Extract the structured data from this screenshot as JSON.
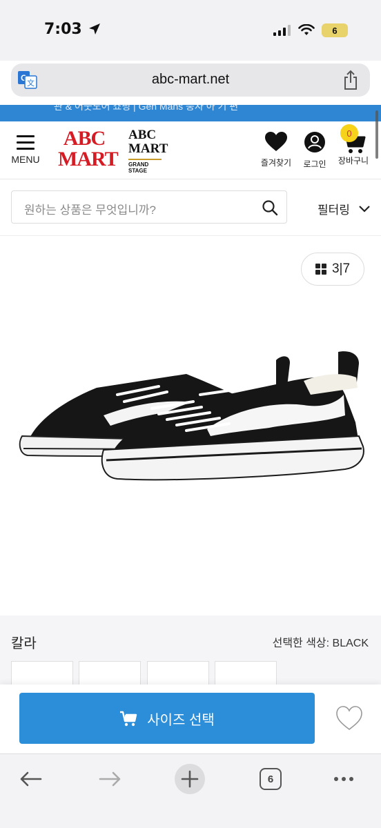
{
  "status_bar": {
    "time": "7:03",
    "battery": "6"
  },
  "browser": {
    "url": "abc-mart.net",
    "tab_count": "6"
  },
  "banner": {
    "text": "관 & 어웃도어 쇼핑 | Gen Mans 풍자 아 기 편"
  },
  "header": {
    "menu_label": "MENU",
    "logo_line1": "ABC",
    "logo_line2": "MART",
    "grand_line1": "ABC",
    "grand_line2": "MART",
    "grand_line3": "GRAND",
    "grand_line4": "STAGE",
    "favorites_label": "즐겨찾기",
    "login_label": "로그인",
    "cart_label": "장바구니",
    "cart_count": "0"
  },
  "search": {
    "placeholder": "원하는 상품은 무엇입니까?",
    "filter_label": "필터링"
  },
  "gallery": {
    "current": "3",
    "total": "7",
    "separator": "|"
  },
  "color": {
    "title": "칼라",
    "selected_label": "선택한 색상: BLACK"
  },
  "actions": {
    "size_select_label": "사이즈 선택"
  },
  "colors": {
    "accent": "#2c8ed8",
    "brand_red": "#d51b23",
    "badge": "#f6d21b"
  }
}
